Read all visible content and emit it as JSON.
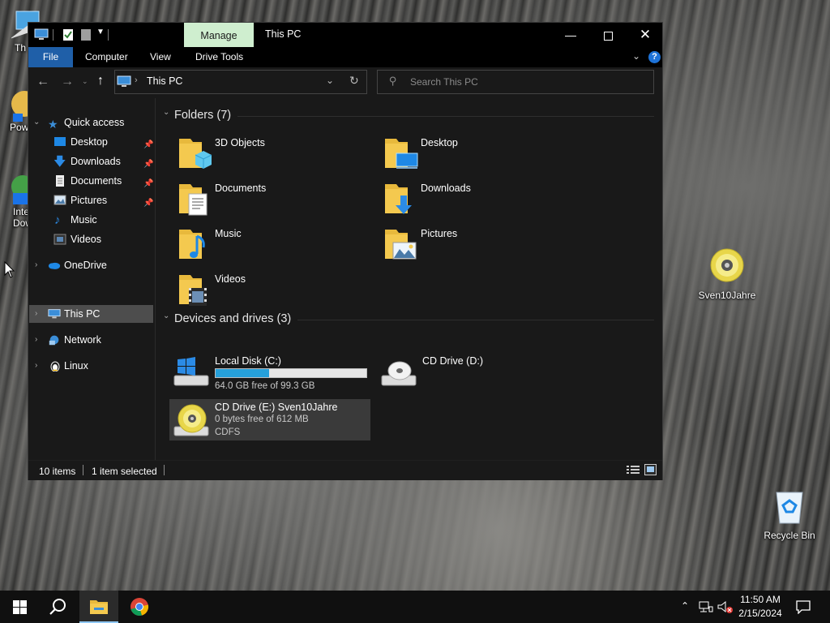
{
  "desktop": {
    "icons": [
      {
        "label": "Th",
        "name": "this-pc-desktop-icon"
      },
      {
        "label": "Pow",
        "name": "power-desktop-icon"
      },
      {
        "label": "Inte Dow",
        "name": "internet-download-desktop-icon"
      },
      {
        "label": "Sven10Jahre",
        "name": "cd-drive-desktop-icon"
      },
      {
        "label": "Recycle Bin",
        "name": "recycle-bin-desktop-icon"
      }
    ]
  },
  "window": {
    "title": "This PC",
    "manage_tab": "Manage",
    "ribbon_tabs": [
      "File",
      "Computer",
      "View",
      "Drive Tools"
    ],
    "address": {
      "location": "This PC"
    },
    "search": {
      "placeholder": "Search This PC"
    }
  },
  "nav": {
    "quick_access": "Quick access",
    "quick_items": [
      {
        "label": "Desktop"
      },
      {
        "label": "Downloads"
      },
      {
        "label": "Documents"
      },
      {
        "label": "Pictures"
      },
      {
        "label": "Music"
      },
      {
        "label": "Videos"
      }
    ],
    "onedrive": "OneDrive",
    "this_pc": "This PC",
    "network": "Network",
    "linux": "Linux"
  },
  "content": {
    "folders_header": "Folders (7)",
    "folders": [
      {
        "label": "3D Objects"
      },
      {
        "label": "Desktop"
      },
      {
        "label": "Documents"
      },
      {
        "label": "Downloads"
      },
      {
        "label": "Music"
      },
      {
        "label": "Pictures"
      },
      {
        "label": "Videos"
      }
    ],
    "devices_header": "Devices and drives (3)",
    "drives": {
      "c": {
        "name": "Local Disk (C:)",
        "free": "64.0 GB free of 99.3 GB",
        "used_fraction": 0.355
      },
      "d": {
        "name": "CD Drive (D:)"
      },
      "e": {
        "name": "CD Drive (E:) Sven10Jahre",
        "free": "0 bytes free of 612 MB",
        "fs": "CDFS"
      }
    }
  },
  "status": {
    "items": "10 items",
    "selected": "1 item selected"
  },
  "taskbar": {
    "time": "11:50 AM",
    "date": "2/15/2024"
  },
  "colors": {
    "manage_tab_bg": "#cfeecf",
    "file_tab_bg": "#1f5fa8",
    "selection_bg": "#3a3a3a",
    "progress_fill": "#26a0da",
    "folder_yellow": "#f4c94f"
  }
}
